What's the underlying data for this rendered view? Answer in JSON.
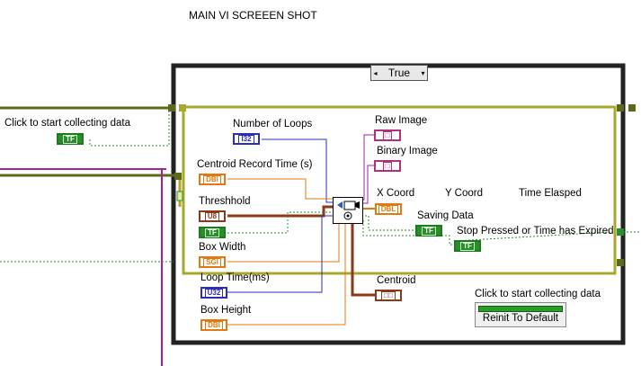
{
  "page_title": "MAIN VI SCREEEN SHOT",
  "case_structure": {
    "selector_value": "True",
    "decrement_arrow": "◂",
    "dropdown_arrow": "▾"
  },
  "outer_control": {
    "label": "Click to start collecting data",
    "type": "TF"
  },
  "controls": {
    "number_of_loops": {
      "label": "Number of Loops",
      "type": "I32"
    },
    "centroid_record_time": {
      "label": "Centroid Record Time (s)",
      "type": "DBl"
    },
    "threshhold": {
      "label": "Threshhold",
      "type": "U8"
    },
    "threshhold_bool": {
      "type": "TF"
    },
    "box_width": {
      "label": "Box Width",
      "type": "SGl"
    },
    "loop_time": {
      "label": "Loop Time(ms)",
      "type": "U32"
    },
    "box_height": {
      "label": "Box Height",
      "type": "DBl"
    }
  },
  "indicators": {
    "raw_image": {
      "label": "Raw Image"
    },
    "binary_image": {
      "label": "Binary Image"
    },
    "x_coord": {
      "label": "X Coord",
      "type": "DBL"
    },
    "y_coord": {
      "label": "Y Coord"
    },
    "time_elapsed": {
      "label": "Time Elasped"
    },
    "saving_data": {
      "label": "Saving Data",
      "type": "TF"
    },
    "stop_pressed": {
      "label": "Stop Pressed or Time has Expired",
      "type": "TF"
    },
    "centroid": {
      "label": "Centroid"
    }
  },
  "front_panel_control": {
    "label": "Click to start collecting data",
    "button_text": "Reinit To Default"
  }
}
